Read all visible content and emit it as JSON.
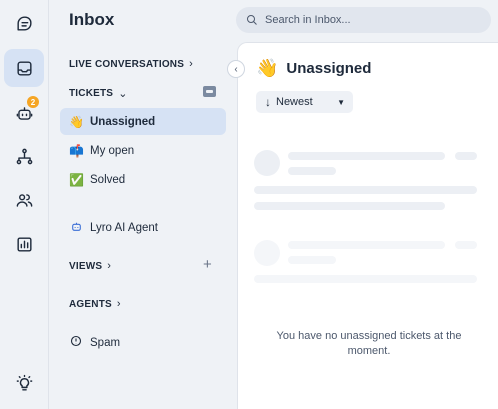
{
  "inbox": {
    "title": "Inbox"
  },
  "rail": {
    "items": [
      {
        "icon": "conversations-icon"
      },
      {
        "icon": "inbox-icon",
        "active": true
      },
      {
        "icon": "bot-icon",
        "badge": "2"
      },
      {
        "icon": "flows-icon"
      },
      {
        "icon": "contacts-icon"
      },
      {
        "icon": "analytics-icon"
      },
      {
        "icon": "lightbulb-icon"
      }
    ]
  },
  "sidebar": {
    "live_conversations": "LIVE CONVERSATIONS",
    "tickets": "TICKETS",
    "ticket_items": [
      {
        "emoji": "👋",
        "label": "Unassigned",
        "active": true
      },
      {
        "emoji": "📫",
        "label": "My open"
      },
      {
        "emoji": "✅",
        "label": "Solved"
      }
    ],
    "lyro": {
      "label": "Lyro AI Agent"
    },
    "views": "VIEWS",
    "agents": "AGENTS",
    "spam": {
      "label": "Spam"
    }
  },
  "search": {
    "placeholder": "Search in Inbox..."
  },
  "main": {
    "title_emoji": "👋",
    "title": "Unassigned",
    "sort_label": "Newest",
    "empty_text": "You have no unassigned tickets at the moment."
  },
  "colors": {
    "accent_active": "#d6e2f4",
    "badge": "#f5a524",
    "background": "#eff2f6"
  }
}
